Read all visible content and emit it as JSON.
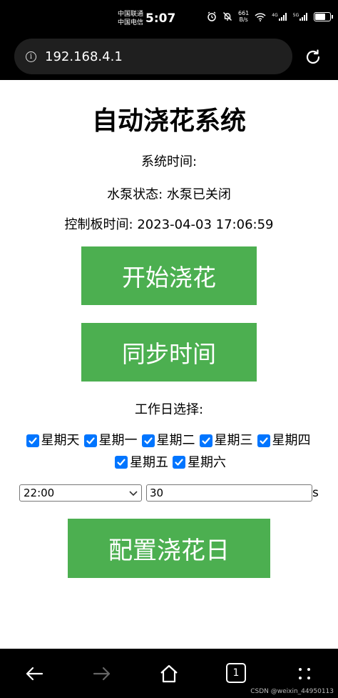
{
  "status_bar": {
    "carrier1": "中国联通",
    "carrier2": "中国电信",
    "time": "5:07",
    "net_speed_value": "661",
    "net_speed_unit": "B/s",
    "signal1_label": "4G",
    "signal2_label": "5G",
    "battery_level": 0.8
  },
  "browser": {
    "url": "192.168.4.1",
    "tab_count": "1"
  },
  "page": {
    "title": "自动浇花系统",
    "system_time_label": "系统时间:",
    "pump_status_label": "水泵状态:",
    "pump_status_value": "水泵已关闭",
    "board_time_label": "控制板时间:",
    "board_time_value": "2023-04-03 17:06:59",
    "start_button": "开始浇花",
    "sync_button": "同步时间",
    "workday_label": "工作日选择:",
    "weekdays": [
      {
        "label": "星期天",
        "checked": true
      },
      {
        "label": "星期一",
        "checked": true
      },
      {
        "label": "星期二",
        "checked": true
      },
      {
        "label": "星期三",
        "checked": true
      },
      {
        "label": "星期四",
        "checked": true
      },
      {
        "label": "星期五",
        "checked": true
      },
      {
        "label": "星期六",
        "checked": true
      }
    ],
    "time_select_value": "22:00",
    "duration_value": "30",
    "duration_unit": "s",
    "config_button": "配置浇花日"
  },
  "watermark": "CSDN @weixin_44950113",
  "colors": {
    "button_green": "#4caf50",
    "checkbox_blue": "#0075ff"
  }
}
